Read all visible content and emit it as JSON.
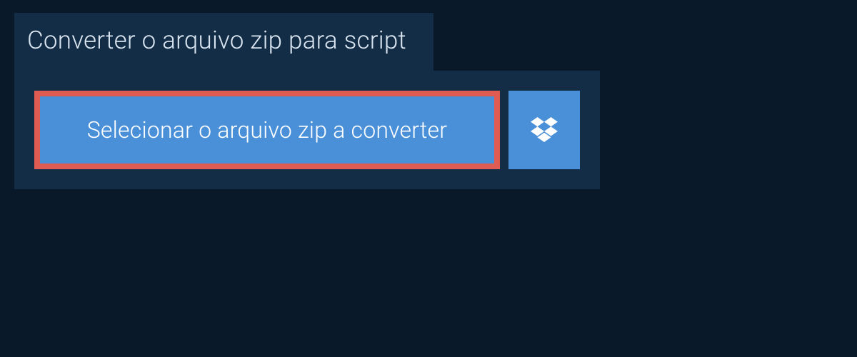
{
  "tab": {
    "label": "Converter o arquivo zip para script"
  },
  "buttons": {
    "select_label": "Selecionar o arquivo zip a converter"
  },
  "colors": {
    "background": "#0a1929",
    "panel": "#142d47",
    "button": "#4a90d9",
    "highlight_border": "#e05c52",
    "text_light": "#d8e4ef",
    "text_white": "#ffffff"
  }
}
